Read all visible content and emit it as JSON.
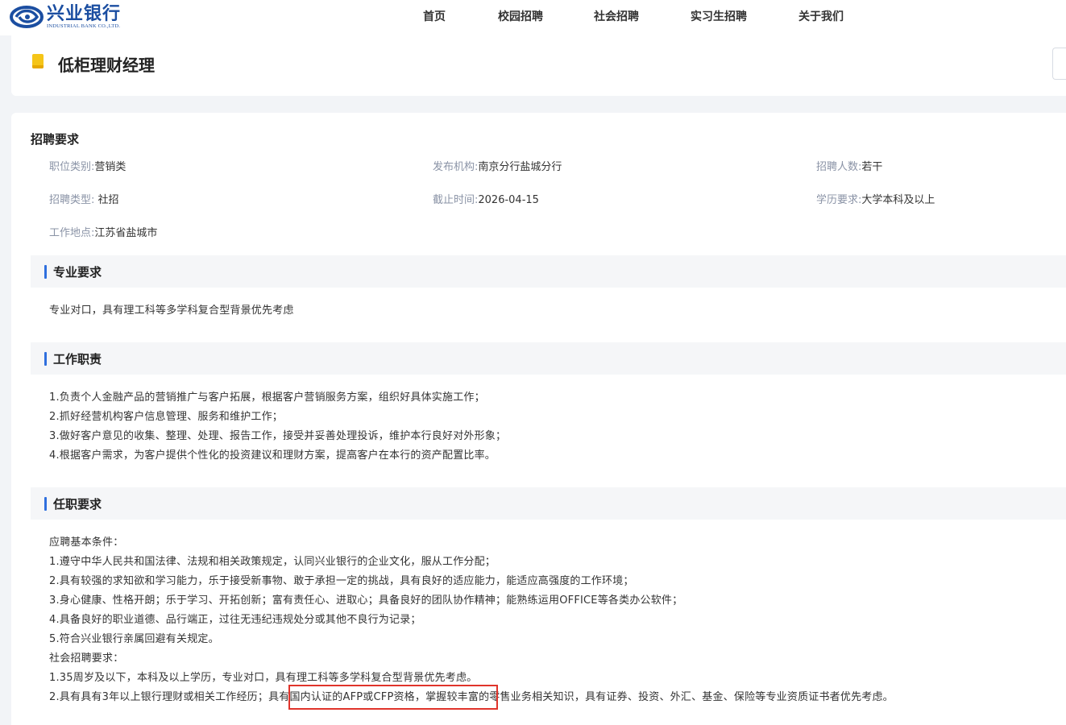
{
  "header": {
    "logo_cn": "兴业银行",
    "logo_en": "INDUSTRIAL BANK CO.,LTD.",
    "nav": [
      "首页",
      "校园招聘",
      "社会招聘",
      "实习生招聘",
      "关于我们"
    ]
  },
  "job": {
    "title": "低柜理财经理"
  },
  "requirements": {
    "heading": "招聘要求",
    "fields": [
      {
        "label": "职位类别:",
        "value": "营销类"
      },
      {
        "label": "发布机构:",
        "value": "南京分行盐城分行"
      },
      {
        "label": "招聘人数:",
        "value": "若干"
      },
      {
        "label": "招聘类型:",
        "value": " 社招"
      },
      {
        "label": "截止时间:",
        "value": "2026-04-15"
      },
      {
        "label": "学历要求:",
        "value": "大学本科及以上"
      },
      {
        "label": "工作地点:",
        "value": "江苏省盐城市"
      }
    ]
  },
  "sections": {
    "major": {
      "title": "专业要求",
      "lines": [
        "专业对口，具有理工科等多学科复合型背景优先考虑"
      ]
    },
    "duties": {
      "title": "工作职责",
      "lines": [
        "1.负责个人金融产品的营销推广与客户拓展，根据客户营销服务方案，组织好具体实施工作；",
        "2.抓好经营机构客户信息管理、服务和维护工作；",
        "3.做好客户意见的收集、整理、处理、报告工作，接受并妥善处理投诉，维护本行良好对外形象；",
        "4.根据客户需求，为客户提供个性化的投资建议和理财方案，提高客户在本行的资产配置比率。"
      ]
    },
    "qualifications": {
      "title": "任职要求",
      "lines": [
        "应聘基本条件：",
        "1.遵守中华人民共和国法律、法规和相关政策规定，认同兴业银行的企业文化，服从工作分配；",
        "2.具有较强的求知欲和学习能力，乐于接受新事物、敢于承担一定的挑战，具有良好的适应能力，能适应高强度的工作环境；",
        "3.身心健康、性格开朗；乐于学习、开拓创新；富有责任心、进取心；具备良好的团队协作精神；能熟练运用OFFICE等各类办公软件；",
        "4.具备良好的职业道德、品行端正，过往无违纪违规处分或其他不良行为记录；",
        "5.符合兴业银行亲属回避有关规定。",
        "社会招聘要求：",
        "1.35周岁及以下，本科及以上学历，专业对口，具有理工科等多学科复合型背景优先考虑。",
        "2.具有具有3年以上银行理财或相关工作经历；具有国内认证的AFP或CFP资格，掌握较丰富的零售业务相关知识，具有证券、投资、外汇、基金、保险等专业资质证书者优先考虑。"
      ]
    }
  },
  "colors": {
    "brand_blue": "#1b4ea1",
    "accent_blue": "#2f6fde",
    "title_flag": "#f5c518",
    "highlight_red": "#e0342b"
  }
}
